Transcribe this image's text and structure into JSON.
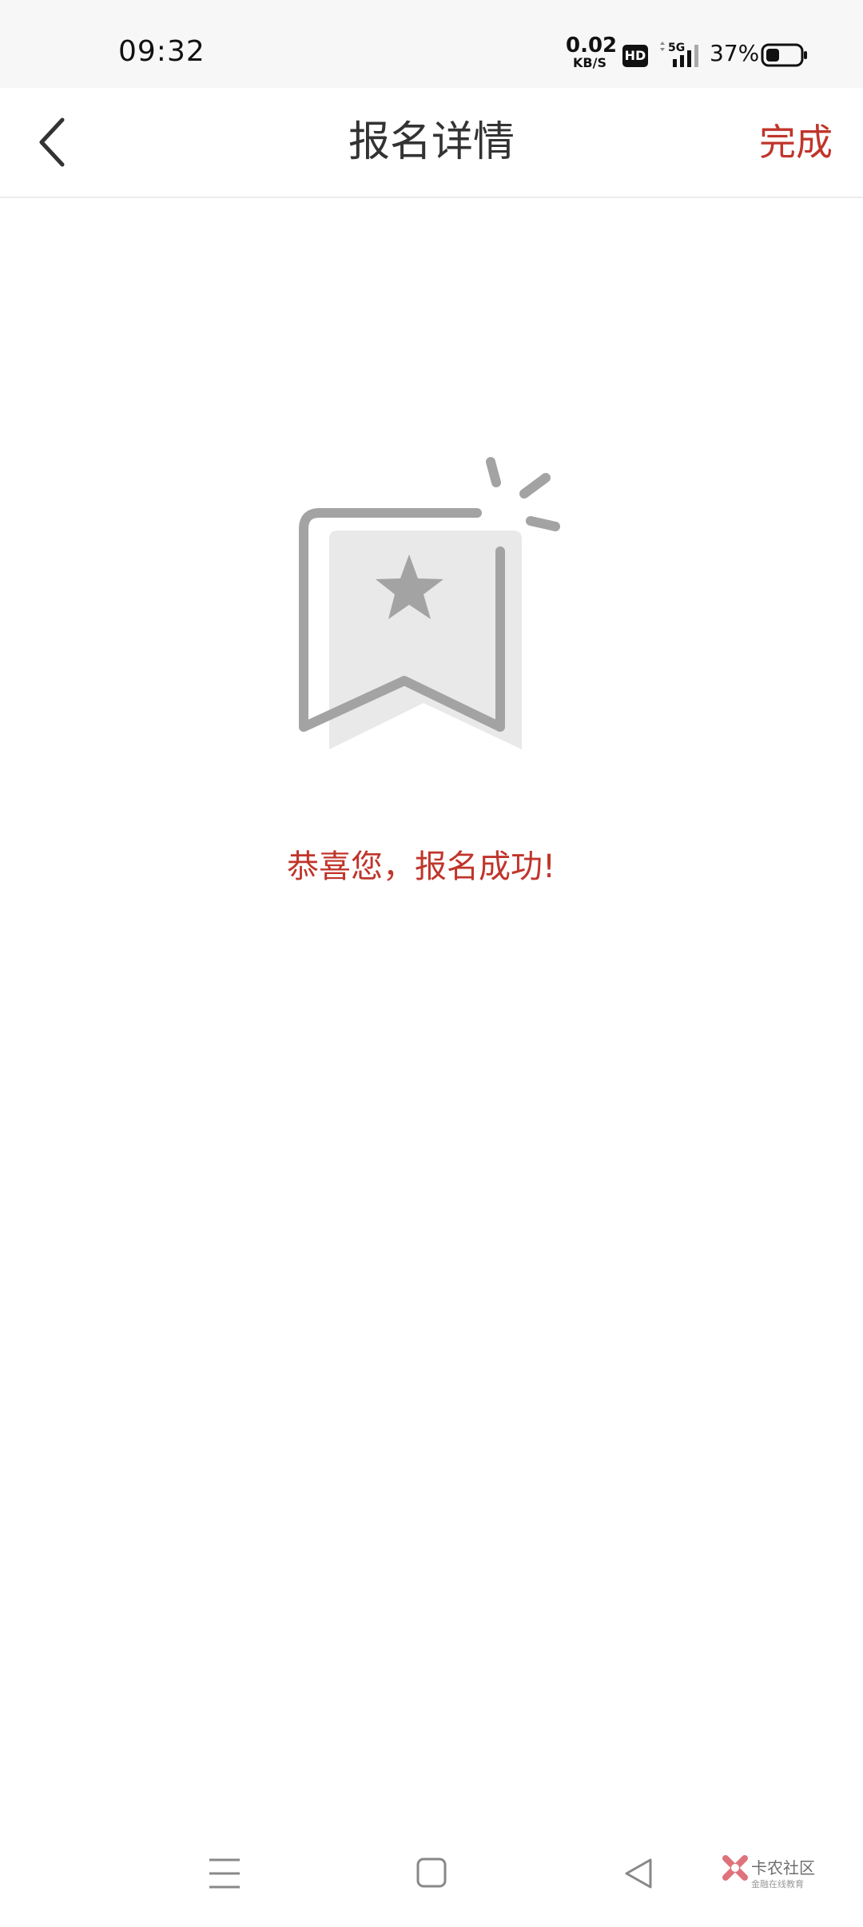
{
  "status_bar": {
    "time": "09:32",
    "net_speed_value": "0.02",
    "net_speed_unit": "KB/S",
    "hd_label": "HD",
    "network_label": "5G",
    "battery_percent": "37%"
  },
  "header": {
    "title": "报名详情",
    "done_label": "完成"
  },
  "main": {
    "success_message": "恭喜您，报名成功!"
  },
  "watermark": {
    "name": "卡农社区",
    "tagline": "金融在线教育"
  },
  "colors": {
    "accent": "#c0352b",
    "title_text": "#333333",
    "status_bar_bg": "#f7f7f7",
    "illustration_gray": "#a3a3a3"
  },
  "icons": {
    "back": "chevron-left-icon",
    "illustration": "bookmark-star-icon",
    "nav_menu": "menu-icon",
    "nav_home": "square-home-icon",
    "nav_back": "triangle-back-icon"
  }
}
